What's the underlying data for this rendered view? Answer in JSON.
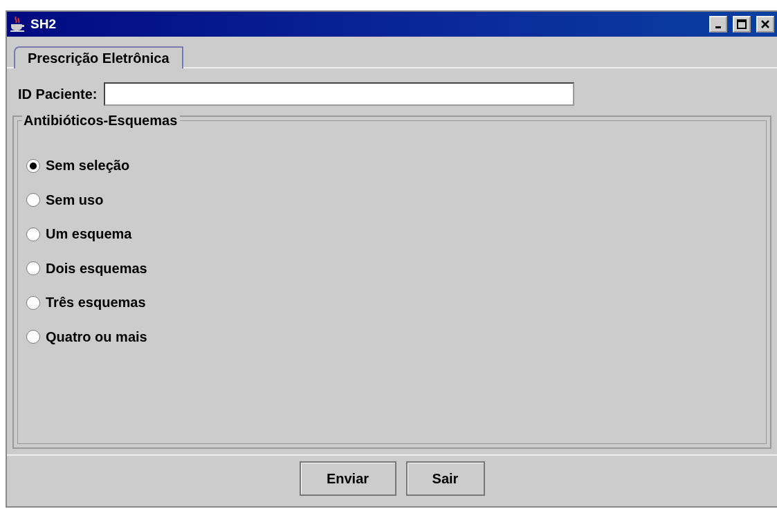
{
  "window": {
    "title": "SH2"
  },
  "tabs": [
    {
      "label": "Prescrição Eletrônica",
      "selected": true
    }
  ],
  "patient_id": {
    "label": "ID Paciente:"
  },
  "group": {
    "title": "Antibióticos-Esquemas",
    "options": [
      {
        "label": "Sem seleção",
        "selected": true
      },
      {
        "label": "Sem uso",
        "selected": false
      },
      {
        "label": "Um esquema",
        "selected": false
      },
      {
        "label": "Dois esquemas",
        "selected": false
      },
      {
        "label": "Três esquemas",
        "selected": false
      },
      {
        "label": "Quatro ou mais",
        "selected": false
      }
    ]
  },
  "buttons": [
    "Enviar",
    "Sair"
  ]
}
